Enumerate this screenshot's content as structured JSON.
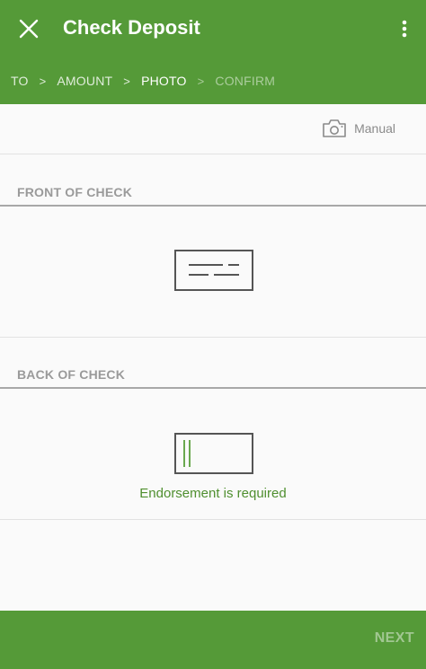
{
  "header": {
    "title": "Check Deposit",
    "background_color": "#559a38"
  },
  "steps": [
    {
      "label": "TO",
      "state": "done"
    },
    {
      "label": "AMOUNT",
      "state": "done"
    },
    {
      "label": "PHOTO",
      "state": "current"
    },
    {
      "label": "CONFIRM",
      "state": "upcoming"
    }
  ],
  "step_separator": ">",
  "manual": {
    "label": "Manual",
    "icon": "camera-icon"
  },
  "front": {
    "label": "FRONT OF CHECK",
    "icon": "check-front-icon"
  },
  "back": {
    "label": "BACK OF CHECK",
    "icon": "check-back-icon",
    "endorsement_note": "Endorsement is required",
    "note_color": "#4f8f2f"
  },
  "footer": {
    "next_label": "NEXT",
    "next_enabled": false
  }
}
